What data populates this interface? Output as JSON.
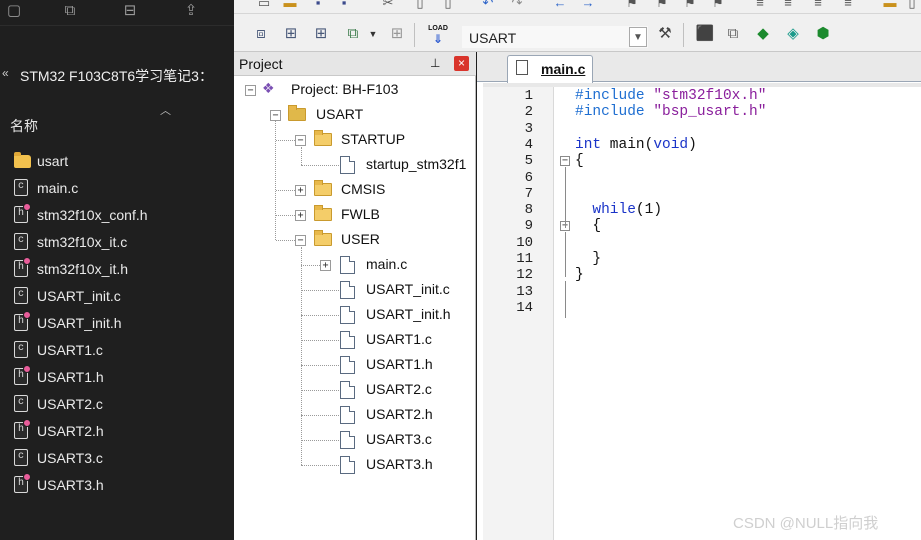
{
  "explorer": {
    "path": "STM32 F103C8T6学习笔记3：",
    "column_header": "名称",
    "files": [
      {
        "name": "usart",
        "type": "folder"
      },
      {
        "name": "main.c",
        "type": "c"
      },
      {
        "name": "stm32f10x_conf.h",
        "type": "h"
      },
      {
        "name": "stm32f10x_it.c",
        "type": "c"
      },
      {
        "name": "stm32f10x_it.h",
        "type": "h"
      },
      {
        "name": "USART_init.c",
        "type": "c"
      },
      {
        "name": "USART_init.h",
        "type": "h"
      },
      {
        "name": "USART1.c",
        "type": "c"
      },
      {
        "name": "USART1.h",
        "type": "h"
      },
      {
        "name": "USART2.c",
        "type": "c"
      },
      {
        "name": "USART2.h",
        "type": "h"
      },
      {
        "name": "USART3.c",
        "type": "c"
      },
      {
        "name": "USART3.h",
        "type": "h"
      }
    ],
    "icon_glyph_c": "c",
    "icon_glyph_h": "h"
  },
  "toolbar": {
    "target": "USART",
    "load_label": "LOAD"
  },
  "project": {
    "title": "Project",
    "pin": "⊥",
    "close": "×",
    "root": "Project: BH-F103",
    "target": "USART",
    "groups": [
      {
        "name": "STARTUP",
        "expanded": true,
        "files": [
          {
            "name": "startup_stm32f1",
            "expandable": false
          }
        ]
      },
      {
        "name": "CMSIS",
        "expanded": false,
        "files": []
      },
      {
        "name": "FWLB",
        "expanded": false,
        "files": []
      },
      {
        "name": "USER",
        "expanded": true,
        "files": [
          {
            "name": "main.c",
            "expandable": true
          },
          {
            "name": "USART_init.c",
            "expandable": false
          },
          {
            "name": "USART_init.h",
            "expandable": false
          },
          {
            "name": "USART1.c",
            "expandable": false
          },
          {
            "name": "USART1.h",
            "expandable": false
          },
          {
            "name": "USART2.c",
            "expandable": false
          },
          {
            "name": "USART2.h",
            "expandable": false
          },
          {
            "name": "USART3.c",
            "expandable": false
          },
          {
            "name": "USART3.h",
            "expandable": false
          }
        ]
      }
    ]
  },
  "editor": {
    "tab": "main.c",
    "line_numbers": [
      "1",
      "2",
      "3",
      "4",
      "5",
      "6",
      "7",
      "8",
      "9",
      "10",
      "11",
      "12",
      "13",
      "14"
    ],
    "lines": [
      [
        {
          "t": "#include ",
          "c": "kw-pp"
        },
        {
          "t": "\"stm32f10x.h\"",
          "c": "str"
        }
      ],
      [
        {
          "t": "#include ",
          "c": "kw-pp"
        },
        {
          "t": "\"bsp_usart.h\"",
          "c": "str"
        }
      ],
      [],
      [
        {
          "t": "int",
          "c": "kw"
        },
        {
          "t": " main(",
          "c": "plain"
        },
        {
          "t": "void",
          "c": "kw"
        },
        {
          "t": ")",
          "c": "plain"
        }
      ],
      [
        {
          "t": "{",
          "c": "plain"
        }
      ],
      [],
      [],
      [
        {
          "t": "  while",
          "c": "kw"
        },
        {
          "t": "(1)",
          "c": "plain"
        }
      ],
      [
        {
          "t": "  {",
          "c": "plain"
        }
      ],
      [],
      [
        {
          "t": "  }",
          "c": "plain"
        }
      ],
      [
        {
          "t": "}",
          "c": "plain"
        }
      ],
      [],
      []
    ]
  },
  "watermark": "CSDN @NULL指向我"
}
